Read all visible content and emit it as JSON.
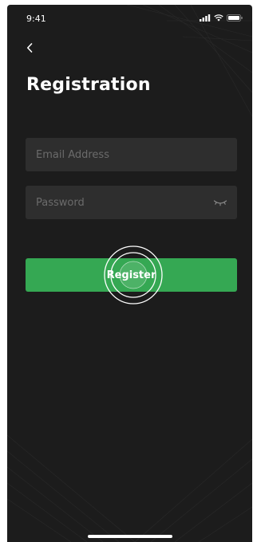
{
  "status_bar": {
    "time": "9:41",
    "icons": [
      "signal-icon",
      "wifi-icon",
      "battery-icon"
    ]
  },
  "nav": {
    "back_icon": "chevron-left-icon"
  },
  "page": {
    "title": "Registration"
  },
  "form": {
    "email": {
      "placeholder": "Email Address",
      "value": ""
    },
    "password": {
      "placeholder": "Password",
      "value": "",
      "toggle_icon": "eye-closed-icon"
    },
    "register_label": "Register"
  },
  "colors": {
    "background": "#1c1c1c",
    "input_background": "#2e2e2e",
    "placeholder": "#6b6b6b",
    "accent": "#35a853",
    "text": "#ffffff"
  }
}
